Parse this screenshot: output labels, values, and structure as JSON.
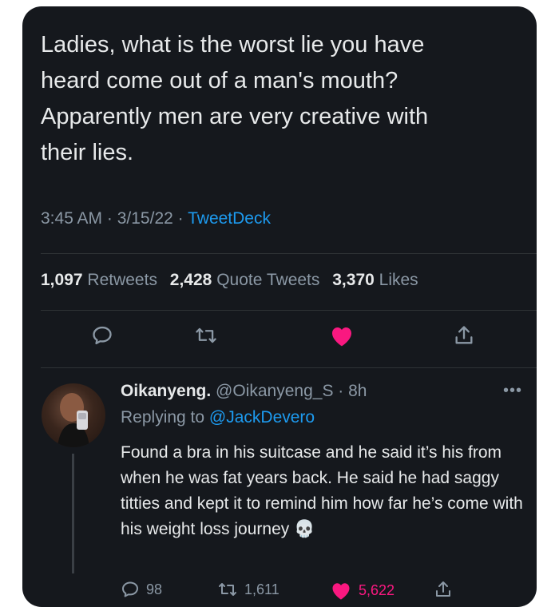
{
  "tweet": {
    "text": "Ladies, what is the worst lie you have\nheard come out of a man's mouth?\nApparently men are very creative with\ntheir lies.",
    "time": "3:45 AM",
    "date": "3/15/22",
    "source": "TweetDeck",
    "retweets_count": "1,097",
    "retweets_label": "Retweets",
    "quotes_count": "2,428",
    "quotes_label": "Quote Tweets",
    "likes_count": "3,370",
    "likes_label": "Likes"
  },
  "reply": {
    "name": "Oikanyeng.",
    "handle": "@Oikanyeng_S",
    "age": "8h",
    "replying_prefix": "Replying to",
    "replying_to": "@JackDevero",
    "text": "Found a bra in his suitcase and he said it’s his from when he was fat years back. He said he had saggy titties and kept it to remind him how far he’s come with his weight loss journey",
    "emoji": "💀",
    "replies": "98",
    "retweets": "1,611",
    "likes": "5,622"
  },
  "colors": {
    "background": "#15181d",
    "link": "#1d9bf0",
    "like": "#f91880",
    "muted": "#8b98a5"
  },
  "icons": [
    "reply-icon",
    "retweet-icon",
    "heart-icon",
    "share-icon",
    "more-icon",
    "skull-emoji"
  ]
}
